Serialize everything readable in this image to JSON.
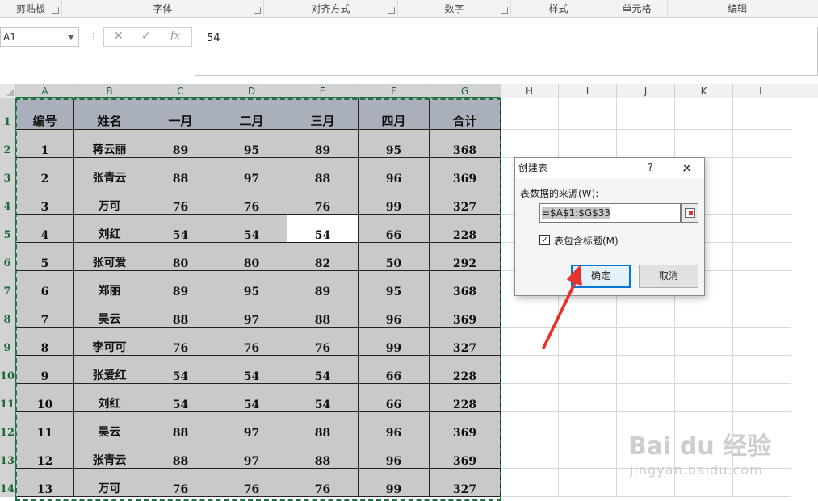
{
  "ribbon": {
    "groups": [
      "剪贴板",
      "字体",
      "对齐方式",
      "数字",
      "样式",
      "单元格",
      "编辑"
    ]
  },
  "formula_bar": {
    "name_box": "A1",
    "formula": "54",
    "icons": [
      "cancel-icon",
      "enter-icon",
      "function-icon"
    ]
  },
  "sheet": {
    "columns": [
      "A",
      "B",
      "C",
      "D",
      "E",
      "F",
      "G",
      "H",
      "I",
      "J",
      "K",
      "L"
    ],
    "rows": [
      "1",
      "2",
      "3",
      "4",
      "5",
      "6",
      "7",
      "8",
      "9",
      "10",
      "11",
      "12",
      "13",
      "14"
    ],
    "header_row": [
      "编号",
      "姓名",
      "一月",
      "二月",
      "三月",
      "四月",
      "合计"
    ],
    "data": [
      [
        "1",
        "蒋云丽",
        "89",
        "95",
        "89",
        "95",
        "368"
      ],
      [
        "2",
        "张青云",
        "88",
        "97",
        "88",
        "96",
        "369"
      ],
      [
        "3",
        "万可",
        "76",
        "76",
        "76",
        "99",
        "327"
      ],
      [
        "4",
        "刘红",
        "54",
        "54",
        "54",
        "66",
        "228"
      ],
      [
        "5",
        "张可爱",
        "80",
        "80",
        "82",
        "50",
        "292"
      ],
      [
        "6",
        "郑丽",
        "89",
        "95",
        "89",
        "95",
        "368"
      ],
      [
        "7",
        "吴云",
        "88",
        "97",
        "88",
        "96",
        "369"
      ],
      [
        "8",
        "李可可",
        "76",
        "76",
        "76",
        "99",
        "327"
      ],
      [
        "9",
        "张爱红",
        "54",
        "54",
        "54",
        "66",
        "228"
      ],
      [
        "10",
        "刘红",
        "54",
        "54",
        "54",
        "66",
        "228"
      ],
      [
        "11",
        "吴云",
        "88",
        "97",
        "88",
        "96",
        "369"
      ],
      [
        "12",
        "张青云",
        "88",
        "97",
        "88",
        "96",
        "369"
      ],
      [
        "13",
        "万可",
        "76",
        "76",
        "76",
        "99",
        "327"
      ]
    ],
    "active_cell": "E5"
  },
  "dialog": {
    "title": "创建表",
    "help": "?",
    "close": "✕",
    "source_label": "表数据的来源(W):",
    "source_value": "=$A$1:$G$33",
    "checkbox_label": "表包含标题(M)",
    "checkbox_checked": "✓",
    "ok_label": "确定",
    "cancel_label": "取消"
  },
  "watermark": {
    "brand": "Bai du 经验",
    "url": "jingyan.baidu.com"
  },
  "colors": {
    "selection_border": "#217346",
    "table_fill": "#c9c9c9",
    "header_fill": "#aab0bb",
    "arrow": "#e8332a",
    "ok_border": "#0078d7"
  }
}
